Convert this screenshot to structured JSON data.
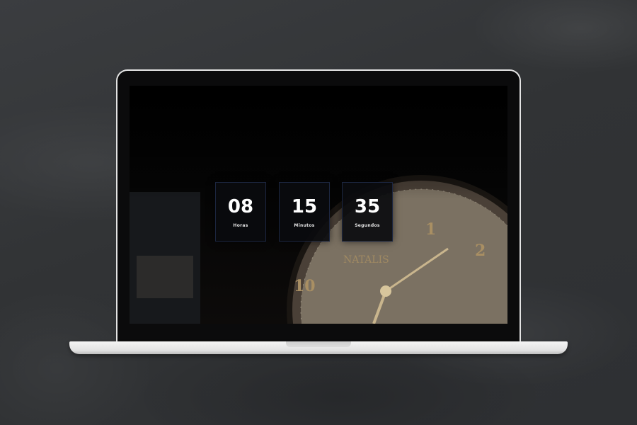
{
  "countdown": {
    "hours": {
      "value": "08",
      "label": "Horas"
    },
    "minutes": {
      "value": "15",
      "label": "Minutos"
    },
    "seconds": {
      "value": "35",
      "label": "Segundos"
    }
  },
  "background_photo": {
    "subject": "pocket-watch",
    "dial_text": "NATALIS"
  },
  "colors": {
    "chalkboard": "#35373a",
    "screen": "#000000",
    "tile_background": "#0a0b0e",
    "tile_border": "#1c2640",
    "digits": "#ffffff",
    "laptop_frame": "#e3e3e3"
  }
}
